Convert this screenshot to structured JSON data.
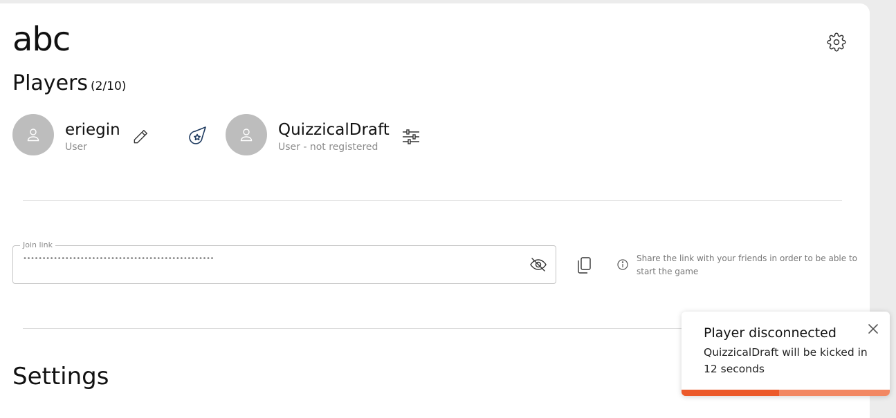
{
  "game": {
    "title": "abc"
  },
  "players": {
    "heading": "Players",
    "count": "(2/10)",
    "list": [
      {
        "name": "eriegin",
        "role": "User",
        "action_icon": "pencil-icon"
      },
      {
        "name": "QuizzicalDraft",
        "role": "User - not registered",
        "action_icon": "sliders-icon"
      }
    ],
    "host_icon": "comet-icon"
  },
  "join_link": {
    "label": "Join link",
    "value": "••••••••••••••••••••••••••••••••••••••••••••••••••",
    "visibility_icon": "eye-off-icon",
    "copy_icon": "copy-icon",
    "info_text": "Share the link with your friends in order to be able to start the game"
  },
  "settings": {
    "heading": "Settings"
  },
  "toast": {
    "title": "Player disconnected",
    "message": "QuizzicalDraft will be kicked in 12 seconds",
    "progress": 0.47,
    "colors": {
      "fill": "#ec5a2b",
      "track": "#f28863"
    }
  }
}
